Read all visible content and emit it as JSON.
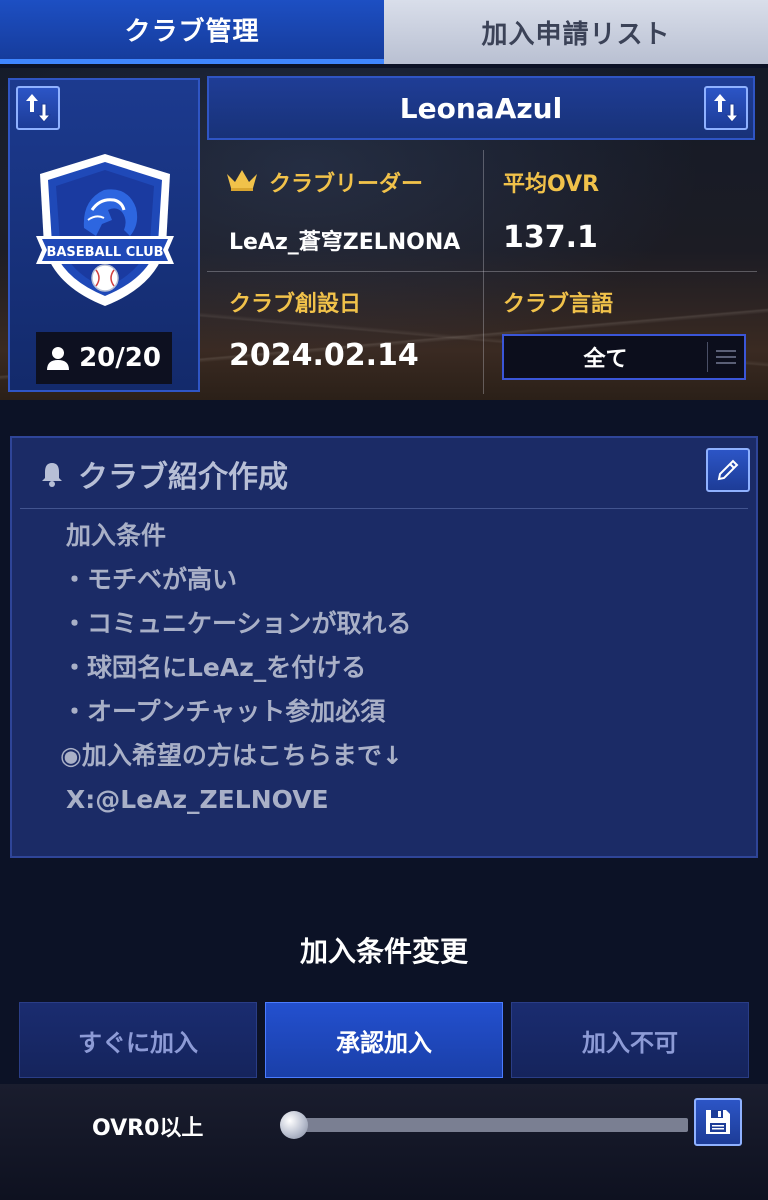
{
  "tabs": {
    "club_management": "クラブ管理",
    "join_request_list": "加入申請リスト"
  },
  "club": {
    "name": "LeonaAzul",
    "members": "20/20",
    "crest_text": "BASEBALL CLUB",
    "leader_label": "クラブリーダー",
    "leader_value": "LeAz_蒼穹ZELNONA",
    "avg_ovr_label": "平均OVR",
    "avg_ovr_value": "137.1",
    "founded_label": "クラブ創設日",
    "founded_value": "2024.02.14",
    "language_label": "クラブ言語",
    "language_value": "全て"
  },
  "intro": {
    "title": "クラブ紹介作成",
    "lines": [
      "加入条件",
      "・モチベが高い",
      "・コミュニケーションが取れる",
      "・球団名にLeAz_を付ける",
      "・オープンチャット参加必須",
      "◉加入希望の方はこちらまで↓",
      "X:@LeAz_ZELNOVE"
    ]
  },
  "join_condition": {
    "title": "加入条件変更",
    "options": [
      "すぐに加入",
      "承認加入",
      "加入不可"
    ],
    "selected": "承認加入",
    "ovr_label": "OVR0以上",
    "ovr_min": 0
  },
  "icons": {
    "swap": "swap-icon",
    "crown": "crown-icon",
    "person": "person-icon",
    "bell": "bell-icon",
    "edit": "pencil-icon",
    "save": "floppy-disk-icon",
    "menu": "menu-icon"
  },
  "colors": {
    "accent": "#1d4fc3",
    "gold_label": "#f1c24a",
    "panel": "#1b2b66"
  }
}
